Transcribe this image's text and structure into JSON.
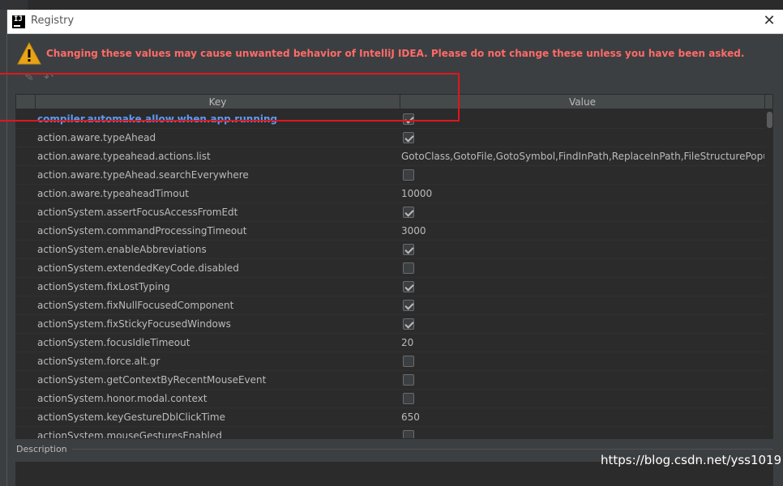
{
  "window": {
    "title": "Registry",
    "logo_text": "IJ"
  },
  "editor_fragment": "· · · ·",
  "warning": {
    "icon": "warning-triangle-icon",
    "message": "Changing these values may cause unwanted behavior of IntelliJ IDEA. Please do not change these unless you have been asked."
  },
  "toolbar": {
    "edit_icon": "edit-icon",
    "revert_icon": "revert-icon"
  },
  "table": {
    "columns": {
      "key": "Key",
      "value": "Value"
    },
    "rows": [
      {
        "key": "compiler.automake.allow.when.app.running",
        "type": "checkbox",
        "checked": true,
        "changed": true
      },
      {
        "key": "action.aware.typeAhead",
        "type": "checkbox",
        "checked": true
      },
      {
        "key": "action.aware.typeahead.actions.list",
        "type": "text",
        "value": "GotoClass,GotoFile,GotoSymbol,FindInPath,ReplaceInPath,FileStructurePopup"
      },
      {
        "key": "action.aware.typeAhead.searchEverywhere",
        "type": "checkbox",
        "checked": false
      },
      {
        "key": "action.aware.typeaheadTimout",
        "type": "text",
        "value": "10000"
      },
      {
        "key": "actionSystem.assertFocusAccessFromEdt",
        "type": "checkbox",
        "checked": true
      },
      {
        "key": "actionSystem.commandProcessingTimeout",
        "type": "text",
        "value": "3000"
      },
      {
        "key": "actionSystem.enableAbbreviations",
        "type": "checkbox",
        "checked": true
      },
      {
        "key": "actionSystem.extendedKeyCode.disabled",
        "type": "checkbox",
        "checked": false
      },
      {
        "key": "actionSystem.fixLostTyping",
        "type": "checkbox",
        "checked": true
      },
      {
        "key": "actionSystem.fixNullFocusedComponent",
        "type": "checkbox",
        "checked": true
      },
      {
        "key": "actionSystem.fixStickyFocusedWindows",
        "type": "checkbox",
        "checked": true
      },
      {
        "key": "actionSystem.focusIdleTimeout",
        "type": "text",
        "value": "20"
      },
      {
        "key": "actionSystem.force.alt.gr",
        "type": "checkbox",
        "checked": false
      },
      {
        "key": "actionSystem.getContextByRecentMouseEvent",
        "type": "checkbox",
        "checked": false
      },
      {
        "key": "actionSystem.honor.modal.context",
        "type": "checkbox",
        "checked": false
      },
      {
        "key": "actionSystem.keyGestureDblClickTime",
        "type": "text",
        "value": "650"
      },
      {
        "key": "actionSystem.mouseGesturesEnabled",
        "type": "checkbox",
        "checked": false
      }
    ]
  },
  "description": {
    "label": "Description"
  },
  "watermark": "https://blog.csdn.net/yss1019",
  "colors": {
    "warning": "#ff6b68",
    "changed_key": "#589df6",
    "highlight": "#e0161c"
  }
}
